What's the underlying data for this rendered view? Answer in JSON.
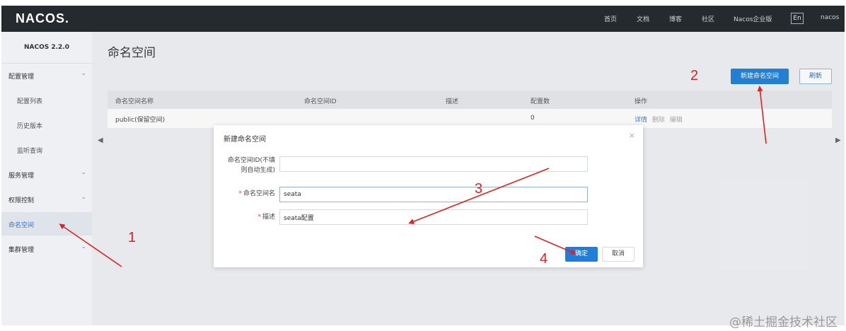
{
  "topbar": {
    "logo": "NACOS.",
    "nav": [
      "首页",
      "文档",
      "博客",
      "社区",
      "Nacos企业版"
    ],
    "lang": "En",
    "user": "nacos"
  },
  "sidebar": {
    "brand": "NACOS 2.2.0",
    "items": [
      {
        "label": "配置管理",
        "type": "group",
        "expandable": true
      },
      {
        "label": "配置列表",
        "type": "sub"
      },
      {
        "label": "历史版本",
        "type": "sub"
      },
      {
        "label": "监听查询",
        "type": "sub"
      },
      {
        "label": "服务管理",
        "type": "group",
        "expandable": true
      },
      {
        "label": "权限控制",
        "type": "group",
        "expandable": true
      },
      {
        "label": "命名空间",
        "type": "group",
        "active": true
      },
      {
        "label": "集群管理",
        "type": "group",
        "expandable": true
      }
    ]
  },
  "main": {
    "title": "命名空间",
    "new_button": "新建命名空间",
    "refresh_button": "刷新",
    "table": {
      "columns": [
        "命名空间名称",
        "命名空间ID",
        "描述",
        "配置数",
        "操作"
      ],
      "rows": [
        {
          "name": "public(保留空间)",
          "id": "",
          "desc": "",
          "count": "0",
          "ops": [
            "详情",
            "删除",
            "编辑"
          ]
        }
      ]
    }
  },
  "dialog": {
    "title": "新建命名空间",
    "close": "×",
    "fields": {
      "id_label_line1": "命名空间ID(不填",
      "id_label_line2": "则自动生成)",
      "id_value": "",
      "name_label": "命名空间名",
      "name_value": "seata",
      "desc_label": "描述",
      "desc_value": "seata配置",
      "required_mark": "*"
    },
    "ok": "确定",
    "cancel": "取消"
  },
  "annotations": [
    "1",
    "2",
    "3",
    "4"
  ],
  "watermark": "@稀土掘金技术社区",
  "colors": {
    "accent": "#1f7fd8",
    "annotation": "#e02222",
    "topbar": "#252a2f"
  }
}
